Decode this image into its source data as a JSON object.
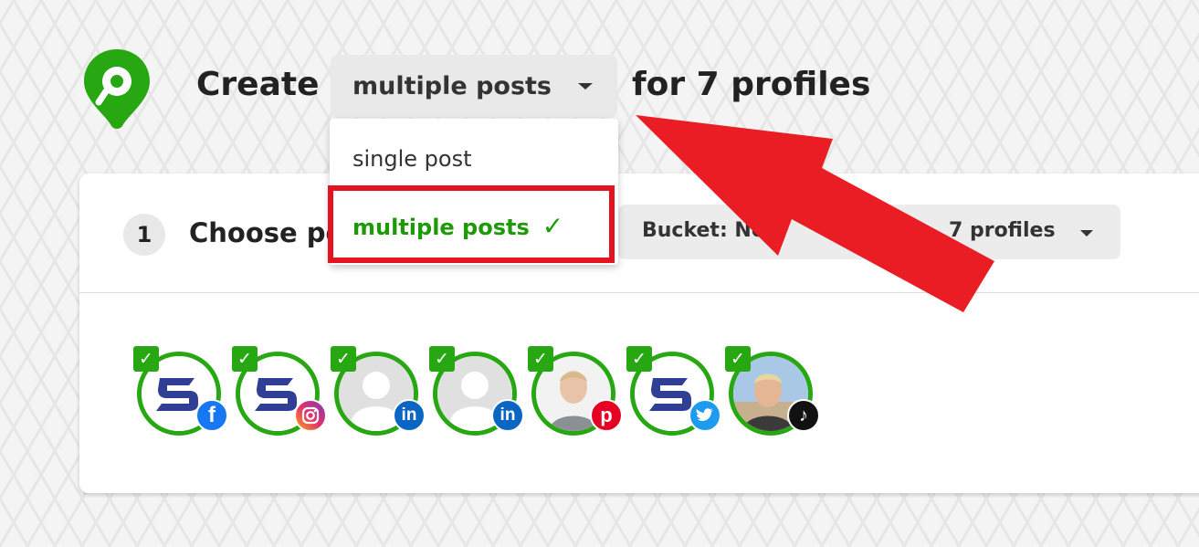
{
  "header": {
    "create_label": "Create",
    "mode_select": {
      "value": "multiple posts"
    },
    "for_label": "for 7 profiles"
  },
  "dropdown": {
    "options": [
      {
        "label": "single post",
        "selected": false
      },
      {
        "label": "multiple posts",
        "selected": true
      }
    ]
  },
  "step": {
    "number": "1",
    "title": "Choose po",
    "bucket_label": "Bucket: No",
    "profiles_label": "7 profiles"
  },
  "profiles": [
    {
      "network": "facebook",
      "network_icon": "facebook-icon",
      "checked": true
    },
    {
      "network": "instagram",
      "network_icon": "instagram-icon",
      "checked": true
    },
    {
      "network": "linkedin",
      "network_icon": "linkedin-icon",
      "checked": true
    },
    {
      "network": "linkedin",
      "network_icon": "linkedin-icon",
      "checked": true
    },
    {
      "network": "pinterest",
      "network_icon": "pinterest-icon",
      "checked": true
    },
    {
      "network": "twitter",
      "network_icon": "twitter-icon",
      "checked": true
    },
    {
      "network": "tiktok",
      "network_icon": "tiktok-icon",
      "checked": true
    }
  ],
  "colors": {
    "brand_green": "#27a712",
    "selected_text": "#1e9a08",
    "highlight_red": "#e3141f"
  }
}
